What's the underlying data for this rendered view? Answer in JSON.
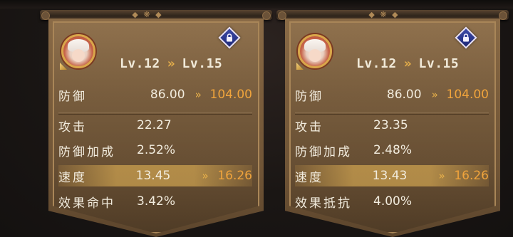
{
  "panels": [
    {
      "level": {
        "from": "Lv.12",
        "arrow": "»",
        "to": "Lv.15"
      },
      "main_stat": {
        "label": "防御",
        "value": "86.00",
        "arrow": "»",
        "next": "104.00"
      },
      "substats": [
        {
          "label": "攻击",
          "value": "22.27"
        },
        {
          "label": "防御加成",
          "value": "2.52%"
        },
        {
          "label": "速度",
          "value": "13.45",
          "arrow": "»",
          "next": "16.26",
          "highlight": true
        },
        {
          "label": "效果命中",
          "value": "3.42%"
        }
      ],
      "locked": true
    },
    {
      "level": {
        "from": "Lv.12",
        "arrow": "»",
        "to": "Lv.15"
      },
      "main_stat": {
        "label": "防御",
        "value": "86.00",
        "arrow": "»",
        "next": "104.00"
      },
      "substats": [
        {
          "label": "攻击",
          "value": "23.35"
        },
        {
          "label": "防御加成",
          "value": "2.48%"
        },
        {
          "label": "速度",
          "value": "13.43",
          "arrow": "»",
          "next": "16.26",
          "highlight": true
        },
        {
          "label": "效果抵抗",
          "value": "4.00%"
        }
      ],
      "locked": true
    }
  ],
  "icons": {
    "lock": "lock-icon",
    "avatar": "character-portrait"
  },
  "colors": {
    "gold_accent": "#e7b04a",
    "next_value": "#f0a43c",
    "banner": "#7a5d3c",
    "lock_badge": "#2f3a96"
  }
}
